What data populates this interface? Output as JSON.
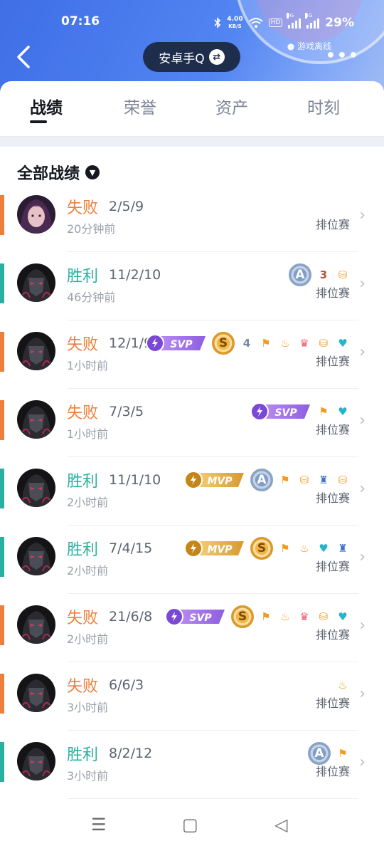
{
  "status": {
    "time": "07:16",
    "speed_value": "4.00",
    "speed_unit": "KB/S",
    "hd": "HD",
    "sig1": "4G",
    "sig2": "4G",
    "battery": "29%"
  },
  "header": {
    "account": "安卓手Q",
    "game_status": "游戏离线"
  },
  "tabs": [
    "战绩",
    "荣誉",
    "资产",
    "时刻"
  ],
  "filter": {
    "label": "全部战绩"
  },
  "colors": {
    "win": "#2ab0a0",
    "loss": "#ef7e3a",
    "header_blue": "#4a7cee"
  },
  "matches": [
    {
      "result": "失败",
      "outcome": "loss",
      "kda": "2/5/9",
      "time": "20分钟前",
      "mode": "排位赛",
      "hero": "pink-hair-hero",
      "badges": []
    },
    {
      "result": "胜利",
      "outcome": "win",
      "kda": "11/2/10",
      "time": "46分钟前",
      "mode": "排位赛",
      "hero": "masked-hero",
      "badges": [
        {
          "type": "medal-a",
          "text": "A"
        },
        {
          "type": "mini",
          "icon": "triple-kill-icon",
          "text": "3",
          "cls": "c-copper"
        },
        {
          "type": "mini",
          "icon": "coins-icon",
          "text": "⛁",
          "cls": "c-orange"
        }
      ]
    },
    {
      "result": "失败",
      "outcome": "loss",
      "kda": "12/1/9",
      "time": "1小时前",
      "mode": "排位赛",
      "hero": "masked-hero",
      "badges": [
        {
          "type": "svp",
          "text": "SVP"
        },
        {
          "type": "medal-s",
          "text": "S"
        },
        {
          "type": "mini",
          "icon": "quadra-kill-icon",
          "text": "4",
          "cls": "c-grey"
        },
        {
          "type": "mini",
          "icon": "flag-icon",
          "text": "⚑",
          "cls": "c-orange"
        },
        {
          "type": "mini",
          "icon": "fire-icon",
          "text": "♨",
          "cls": "c-orange"
        },
        {
          "type": "mini",
          "icon": "crown-icon",
          "text": "♛",
          "cls": "c-red"
        },
        {
          "type": "mini",
          "icon": "coins-icon",
          "text": "⛁",
          "cls": "c-orange"
        },
        {
          "type": "mini",
          "icon": "heart-plus-icon",
          "text": "♥",
          "cls": "c-teal"
        }
      ]
    },
    {
      "result": "失败",
      "outcome": "loss",
      "kda": "7/3/5",
      "time": "1小时前",
      "mode": "排位赛",
      "hero": "masked-hero",
      "badges": [
        {
          "type": "svp",
          "text": "SVP"
        },
        {
          "type": "mini",
          "icon": "flag-icon",
          "text": "⚑",
          "cls": "c-orange"
        },
        {
          "type": "mini",
          "icon": "heart-plus-icon",
          "text": "♥",
          "cls": "c-teal"
        }
      ]
    },
    {
      "result": "胜利",
      "outcome": "win",
      "kda": "11/1/10",
      "time": "2小时前",
      "mode": "排位赛",
      "hero": "masked-hero",
      "badges": [
        {
          "type": "mvp",
          "text": "MVP"
        },
        {
          "type": "medal-a",
          "text": "A"
        },
        {
          "type": "mini",
          "icon": "flag-icon",
          "text": "⚑",
          "cls": "c-orange"
        },
        {
          "type": "mini",
          "icon": "coins-icon",
          "text": "⛁",
          "cls": "c-orange"
        },
        {
          "type": "mini",
          "icon": "tower-icon",
          "text": "♜",
          "cls": "c-blue"
        },
        {
          "type": "mini",
          "icon": "coins-plus-icon",
          "text": "⛁",
          "cls": "c-orange"
        }
      ]
    },
    {
      "result": "胜利",
      "outcome": "win",
      "kda": "7/4/15",
      "time": "2小时前",
      "mode": "排位赛",
      "hero": "masked-hero",
      "badges": [
        {
          "type": "mvp",
          "text": "MVP"
        },
        {
          "type": "medal-s",
          "text": "S"
        },
        {
          "type": "mini",
          "icon": "flag-icon",
          "text": "⚑",
          "cls": "c-orange"
        },
        {
          "type": "mini",
          "icon": "fire-icon",
          "text": "♨",
          "cls": "c-orange"
        },
        {
          "type": "mini",
          "icon": "heart-plus-icon",
          "text": "♥",
          "cls": "c-teal"
        },
        {
          "type": "mini",
          "icon": "tower-icon",
          "text": "♜",
          "cls": "c-blue"
        }
      ]
    },
    {
      "result": "失败",
      "outcome": "loss",
      "kda": "21/6/8",
      "time": "2小时前",
      "mode": "排位赛",
      "hero": "masked-hero",
      "badges": [
        {
          "type": "svp",
          "text": "SVP"
        },
        {
          "type": "medal-s",
          "text": "S"
        },
        {
          "type": "mini",
          "icon": "flag-icon",
          "text": "⚑",
          "cls": "c-orange"
        },
        {
          "type": "mini",
          "icon": "fire-icon",
          "text": "♨",
          "cls": "c-orange"
        },
        {
          "type": "mini",
          "icon": "crown-icon",
          "text": "♛",
          "cls": "c-red"
        },
        {
          "type": "mini",
          "icon": "coins-icon",
          "text": "⛁",
          "cls": "c-orange"
        },
        {
          "type": "mini",
          "icon": "heart-plus-icon",
          "text": "♥",
          "cls": "c-teal"
        }
      ]
    },
    {
      "result": "失败",
      "outcome": "loss",
      "kda": "6/6/3",
      "time": "3小时前",
      "mode": "排位赛",
      "hero": "masked-hero",
      "badges": [
        {
          "type": "mini",
          "icon": "fire-icon",
          "text": "♨",
          "cls": "c-orange"
        }
      ]
    },
    {
      "result": "胜利",
      "outcome": "win",
      "kda": "8/2/12",
      "time": "3小时前",
      "mode": "排位赛",
      "hero": "masked-hero",
      "badges": [
        {
          "type": "medal-a",
          "text": "A"
        },
        {
          "type": "mini",
          "icon": "flag-icon",
          "text": "⚑",
          "cls": "c-orange"
        }
      ]
    }
  ]
}
